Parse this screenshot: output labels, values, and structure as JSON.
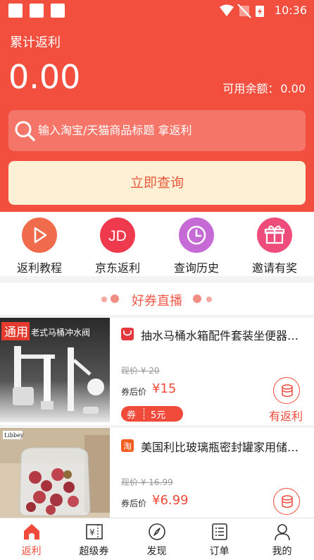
{
  "status_bar": {
    "time": "10:36"
  },
  "header": {
    "title": "累计返利",
    "amount": "0.00",
    "balance_label": "可用余额：",
    "balance_value": "0.00",
    "search_placeholder": "输入淘宝/天猫商品标题 拿返利",
    "query_button": "立即查询"
  },
  "quick_actions": [
    {
      "label": "返利教程",
      "icon": "play-icon",
      "color": "#f06a4c"
    },
    {
      "label": "京东返利",
      "icon": "jd-icon",
      "text": "JD",
      "color": "#ef3a4d"
    },
    {
      "label": "查询历史",
      "icon": "clock-icon",
      "color": "#c66bd6"
    },
    {
      "label": "邀请有奖",
      "icon": "gift-icon",
      "color": "#ee4c7a"
    }
  ],
  "section": {
    "title": "好券直播"
  },
  "products": [
    {
      "store_icon": "tmall-icon",
      "image_text": "通用老式马桶冲水阀",
      "title": "抽水马桶水箱配件套装坐便器进水阀老式通用",
      "original_price": "现价 ¥ 20",
      "after_coupon_label": "券后价",
      "after_coupon_price": "¥15",
      "coupon_tag": "券",
      "coupon_value": "5元",
      "rebate_label": "有返利"
    },
    {
      "store_icon": "taobao-icon",
      "store_text": "淘",
      "image_text": "Libbey",
      "title": "美国利比玻璃瓶密封罐家用储物罐",
      "original_price": "现价 ¥ 16.99",
      "after_coupon_label": "券后价",
      "after_coupon_price": "¥6.99"
    }
  ],
  "tabs": [
    {
      "label": "返利",
      "icon": "home-icon",
      "active": true
    },
    {
      "label": "超级券",
      "icon": "coupon-icon",
      "glyph": "¥"
    },
    {
      "label": "发现",
      "icon": "compass-icon"
    },
    {
      "label": "订单",
      "icon": "order-list-icon"
    },
    {
      "label": "我的",
      "icon": "user-icon"
    }
  ],
  "colors": {
    "primary": "#f24f3f",
    "accent_text": "#e75a3e",
    "button_bg": "#fdf0d4"
  }
}
